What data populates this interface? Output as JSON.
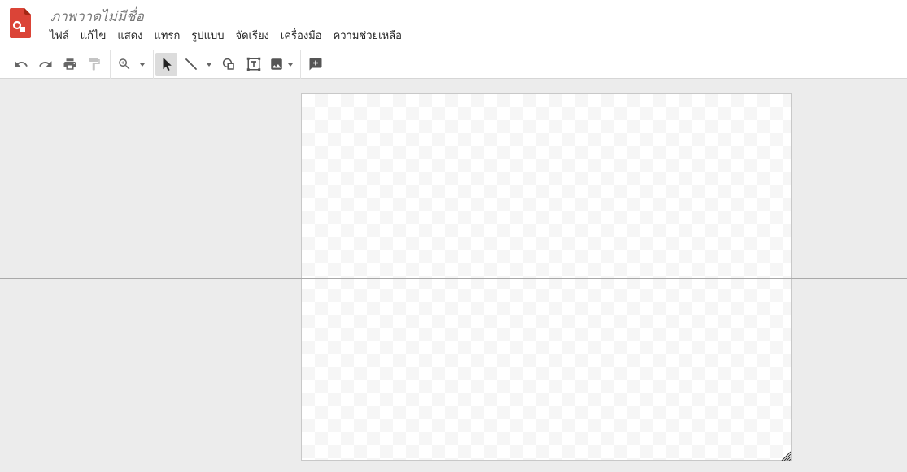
{
  "app": {
    "title": "ภาพวาดไม่มีชื่อ",
    "logo_icon": "google-drawings-logo",
    "logo_color": "#db4437"
  },
  "menu": {
    "items": [
      {
        "label": "ไฟล์"
      },
      {
        "label": "แก้ไข"
      },
      {
        "label": "แสดง"
      },
      {
        "label": "แทรก"
      },
      {
        "label": "รูปแบบ"
      },
      {
        "label": "จัดเรียง"
      },
      {
        "label": "เครื่องมือ"
      },
      {
        "label": "ความช่วยเหลือ"
      }
    ]
  },
  "toolbar": {
    "tools": [
      {
        "icon": "undo-icon"
      },
      {
        "icon": "redo-icon"
      },
      {
        "icon": "print-icon"
      },
      {
        "icon": "paint-format-icon",
        "disabled": true
      },
      {
        "icon": "zoom-icon",
        "has_dropdown": true
      },
      {
        "icon": "select-arrow-icon",
        "active": true
      },
      {
        "icon": "line-icon",
        "has_dropdown": true
      },
      {
        "icon": "shape-icon"
      },
      {
        "icon": "text-box-icon"
      },
      {
        "icon": "image-icon",
        "has_dropdown": true
      },
      {
        "icon": "add-comment-icon"
      }
    ]
  },
  "canvas": {
    "background": "transparent-checkerboard",
    "workspace_color": "#ececec",
    "guide_color": "#a9a9a9"
  }
}
